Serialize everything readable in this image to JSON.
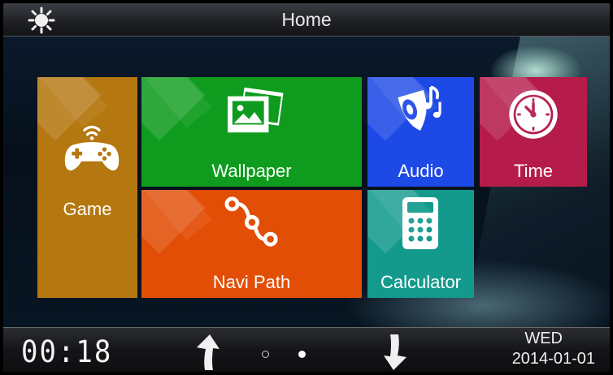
{
  "header": {
    "title": "Home",
    "icon": "brightness-sun-icon"
  },
  "tiles": [
    {
      "id": "game",
      "label": "Game",
      "icon": "gamepad-icon",
      "color": "#b57710"
    },
    {
      "id": "wallpaper",
      "label": "Wallpaper",
      "icon": "pictures-icon",
      "color": "#0f9c1e"
    },
    {
      "id": "audio",
      "label": "Audio",
      "icon": "speaker-music-icon",
      "color": "#1d49e6"
    },
    {
      "id": "time",
      "label": "Time",
      "icon": "clock-icon",
      "color": "#b51c4b"
    },
    {
      "id": "navi",
      "label": "Navi Path",
      "icon": "path-icon",
      "color": "#e24e05"
    },
    {
      "id": "calculator",
      "label": "Calculator",
      "icon": "calculator-icon",
      "color": "#139a8d"
    }
  ],
  "footer": {
    "time": "00:18",
    "day_of_week": "WED",
    "date": "2014-01-01",
    "page_count": 2,
    "current_page": 2
  }
}
